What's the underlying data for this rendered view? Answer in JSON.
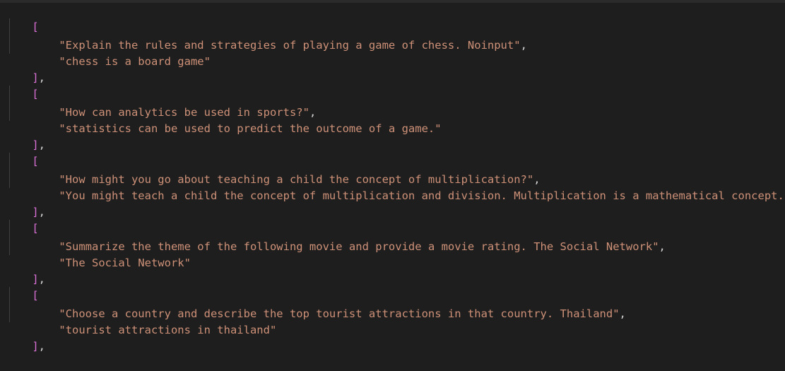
{
  "editor": {
    "open_bracket": "[",
    "close_bracket": "]",
    "separator": ",",
    "entries": [
      {
        "prompt": "\"Explain the rules and strategies of playing a game of chess. Noinput\"",
        "response": "\"chess is a board game\""
      },
      {
        "prompt": "\"How can analytics be used in sports?\"",
        "response": "\"statistics can be used to predict the outcome of a game.\""
      },
      {
        "prompt": "\"How might you go about teaching a child the concept of multiplication?\"",
        "response": "\"You might teach a child the concept of multiplication and division. Multiplication is a mathematical concept."
      },
      {
        "prompt": "\"Summarize the theme of the following movie and provide a movie rating. The Social Network\"",
        "response": "\"The Social Network\""
      },
      {
        "prompt": "\"Choose a country and describe the top tourist attractions in that country. Thailand\"",
        "response": "\"tourist attractions in thailand\""
      }
    ]
  }
}
